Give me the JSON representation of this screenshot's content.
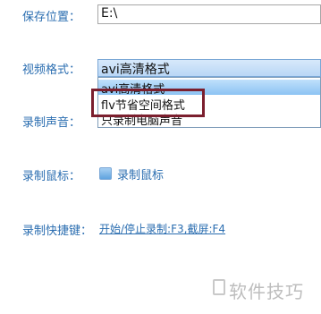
{
  "save_location": {
    "label": "保存位置：",
    "value": "E:\\"
  },
  "video_format": {
    "label": "视频格式：",
    "selected": "avi高清格式",
    "options": [
      "avi高清格式",
      "flv节省空间格式",
      "只录制电脑声音"
    ]
  },
  "record_audio": {
    "label": "录制声音："
  },
  "record_mouse": {
    "label": "录制鼠标：",
    "checkbox_label": "录制鼠标"
  },
  "hotkeys": {
    "label": "录制快捷键：",
    "value": "开始/停止录制:F3,截屏:F4"
  },
  "watermark": "软件技巧"
}
